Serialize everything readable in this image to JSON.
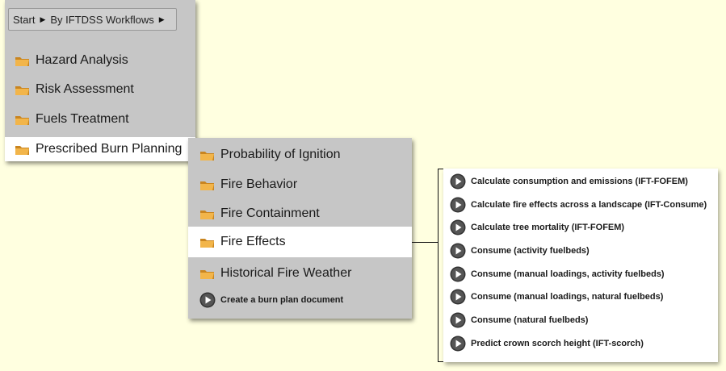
{
  "breadcrumb": {
    "start": "Start",
    "workflows": "By IFTDSS Workflows"
  },
  "menu_level1": {
    "items": [
      {
        "label": "Hazard Analysis",
        "icon": "folder-icon"
      },
      {
        "label": "Risk Assessment",
        "icon": "folder-icon"
      },
      {
        "label": "Fuels Treatment",
        "icon": "folder-icon"
      },
      {
        "label": "Prescribed Burn Planning",
        "icon": "folder-icon",
        "selected": true
      }
    ]
  },
  "menu_level2": {
    "items": [
      {
        "label": "Probability of Ignition",
        "icon": "folder-icon"
      },
      {
        "label": "Fire Behavior",
        "icon": "folder-icon"
      },
      {
        "label": "Fire Containment",
        "icon": "folder-icon"
      },
      {
        "label": "Fire Effects",
        "icon": "folder-icon",
        "selected": true
      },
      {
        "label": "Historical Fire Weather",
        "icon": "folder-icon"
      },
      {
        "label": "Create a burn plan document",
        "icon": "play-icon"
      }
    ]
  },
  "menu_level3": {
    "items": [
      "Calculate consumption and emissions (IFT-FOFEM)",
      "Calculate fire effects across a landscape (IFT-Consume)",
      "Calculate tree mortality (IFT-FOFEM)",
      "Consume (activity fuelbeds)",
      "Consume (manual loadings, activity fuelbeds)",
      "Consume (manual loadings, natural fuelbeds)",
      "Consume (natural fuelbeds)",
      "Predict crown scorch height (IFT-scorch)"
    ]
  },
  "colors": {
    "background": "#ffffe0",
    "panel": "#c6c6c6",
    "selected": "#ffffff",
    "folder": "#e8a53a"
  }
}
